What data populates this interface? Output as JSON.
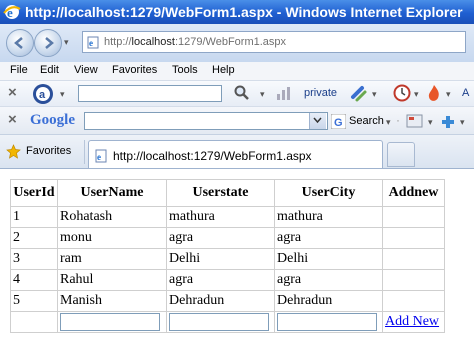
{
  "window": {
    "title": "http://localhost:1279/WebForm1.aspx - Windows Internet Explorer"
  },
  "address": {
    "prefix": "http://",
    "host": "localhost",
    "rest": ":1279/WebForm1.aspx"
  },
  "menu": [
    "File",
    "Edit",
    "View",
    "Favorites",
    "Tools",
    "Help"
  ],
  "toolbar1": {
    "private_label": "private",
    "search_value": "",
    "cut_label": "A"
  },
  "google": {
    "logo": "Google",
    "search_label": "Search",
    "search_value": ""
  },
  "favorites": {
    "label": "Favorites"
  },
  "tab": {
    "label": "http://localhost:1279/WebForm1.aspx"
  },
  "grid": {
    "headers": [
      "UserId",
      "UserName",
      "Userstate",
      "UserCity",
      "Addnew"
    ],
    "rows": [
      [
        "1",
        "Rohatash",
        "mathura",
        "mathura",
        ""
      ],
      [
        "2",
        "monu",
        "agra",
        "agra",
        ""
      ],
      [
        "3",
        "ram",
        "Delhi",
        "Delhi",
        ""
      ],
      [
        "4",
        "Rahul",
        "agra",
        "agra",
        ""
      ],
      [
        "5",
        "Manish",
        "Dehradun",
        "Dehradun",
        ""
      ]
    ],
    "footer": {
      "name_value": "",
      "state_value": "",
      "city_value": "",
      "add_link": "Add New"
    }
  },
  "colors": {
    "titlebar": "#1f5fd1",
    "link": "#0000ee",
    "grid_border": "#cfcfcf"
  },
  "icons": [
    "ie-logo-icon",
    "back-icon",
    "forward-icon",
    "page-icon",
    "close-icon",
    "search-icon",
    "star-icon",
    "rss-icon",
    "google-g-icon"
  ]
}
